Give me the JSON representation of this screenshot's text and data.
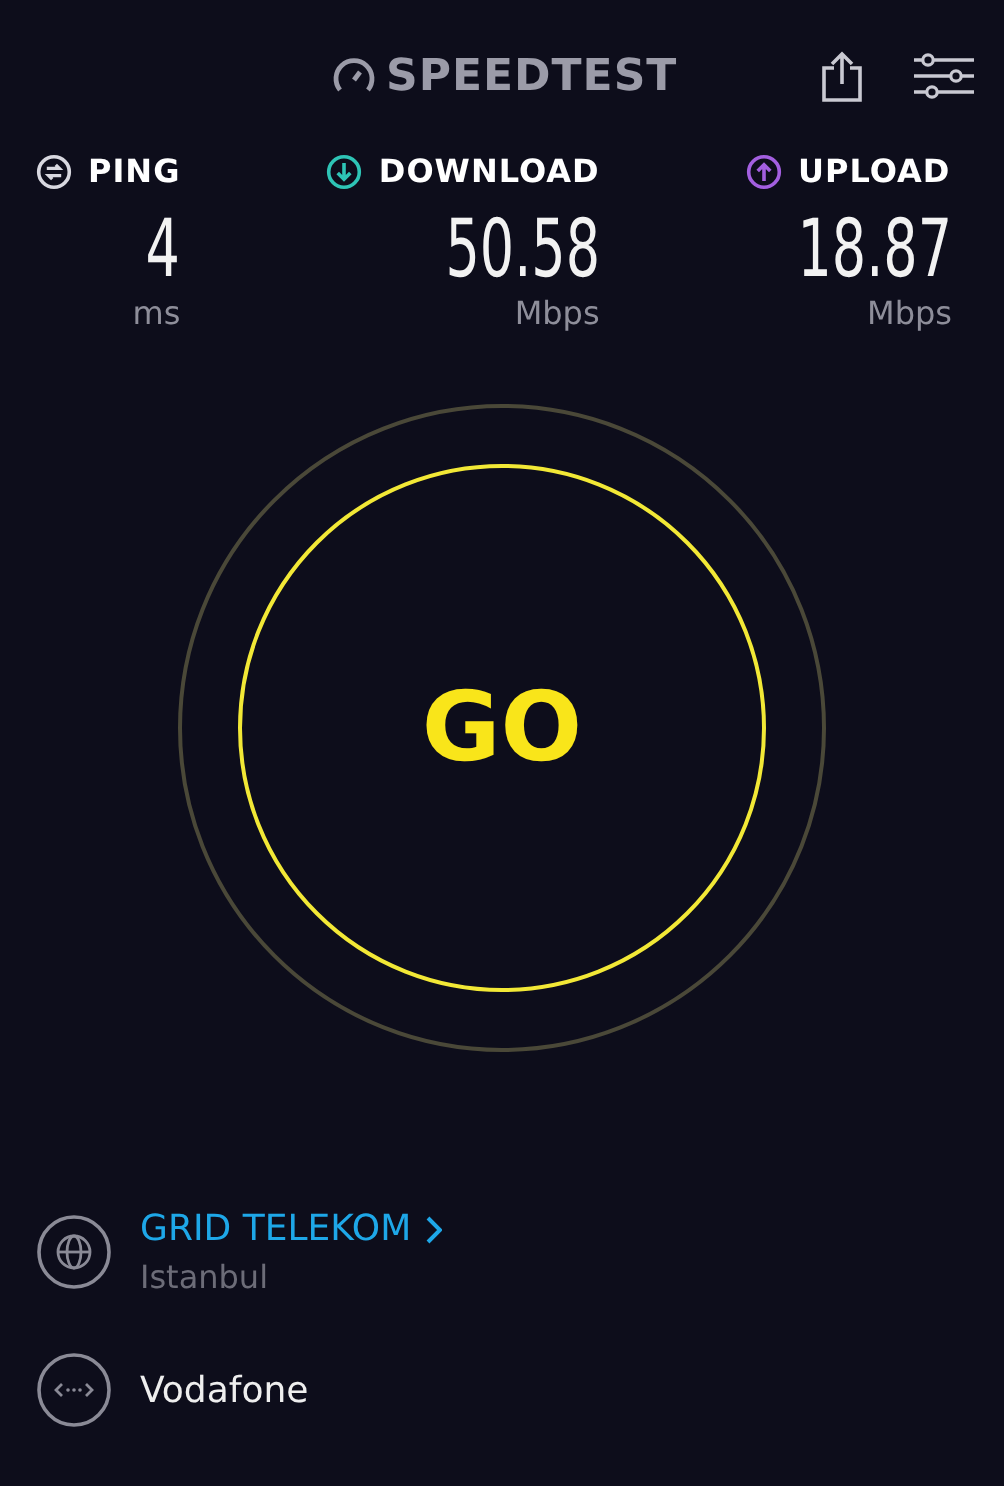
{
  "header": {
    "logo": "SPEEDTEST"
  },
  "metrics": [
    {
      "kind": "ping",
      "label": "PING",
      "value": "4",
      "unit": "ms"
    },
    {
      "kind": "download",
      "label": "DOWNLOAD",
      "value": "50.58",
      "unit": "Mbps"
    },
    {
      "kind": "upload",
      "label": "UPLOAD",
      "value": "18.87",
      "unit": "Mbps"
    }
  ],
  "go_button": {
    "label": "GO"
  },
  "server": {
    "name": "GRID TELEKOM",
    "location": "Istanbul"
  },
  "provider": {
    "name": "Vodafone"
  }
}
